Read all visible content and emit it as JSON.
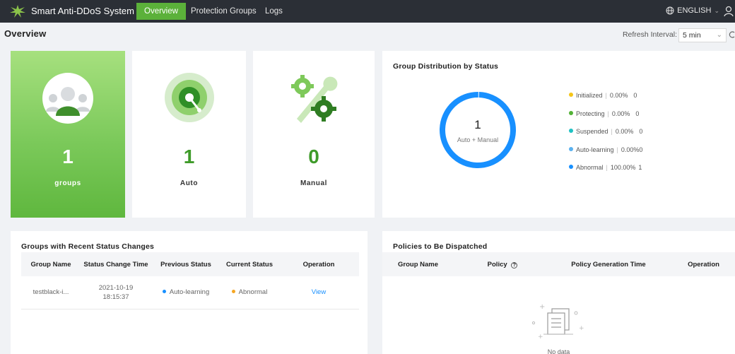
{
  "topbar": {
    "app_name": "Smart Anti-DDoS System",
    "tabs": [
      {
        "label": "Overview",
        "active": true
      },
      {
        "label": "Protection Groups",
        "active": false
      },
      {
        "label": "Logs",
        "active": false
      }
    ],
    "language": "ENGLISH"
  },
  "page": {
    "title": "Overview",
    "refresh_label": "Refresh Interval:",
    "refresh_value": "5 min"
  },
  "stats": {
    "groups": {
      "value": "1",
      "label": "groups"
    },
    "auto": {
      "value": "1",
      "label": "Auto"
    },
    "manual": {
      "value": "0",
      "label": "Manual"
    }
  },
  "distribution": {
    "title": "Group Distribution by Status",
    "total": "1",
    "subtitle": "Auto + Manual",
    "legend": [
      {
        "name": "Initialized",
        "percent": "0.00%",
        "count": "0",
        "color": "#f5c518"
      },
      {
        "name": "Protecting",
        "percent": "0.00%",
        "count": "0",
        "color": "#52b236"
      },
      {
        "name": "Suspended",
        "percent": "0.00%",
        "count": "0",
        "color": "#1fc1c3"
      },
      {
        "name": "Auto-learning",
        "percent": "0.00%",
        "count": "0",
        "color": "#5ab1ef"
      },
      {
        "name": "Abnormal",
        "percent": "100.00%",
        "count": "1",
        "color": "#1890ff"
      }
    ]
  },
  "chart_data": {
    "type": "pie",
    "title": "Group Distribution by Status",
    "categories": [
      "Initialized",
      "Protecting",
      "Suspended",
      "Auto-learning",
      "Abnormal"
    ],
    "values": [
      0,
      0,
      0,
      0,
      1
    ],
    "percentages": [
      0.0,
      0.0,
      0.0,
      0.0,
      100.0
    ],
    "legend_position": "right"
  },
  "recent_changes": {
    "title": "Groups with Recent Status Changes",
    "columns": [
      "Group Name",
      "Status Change Time",
      "Previous Status",
      "Current Status",
      "Operation"
    ],
    "rows": [
      {
        "group_name": "testblack-i...",
        "change_date": "2021-10-19",
        "change_time": "18:15:37",
        "previous_status": "Auto-learning",
        "previous_color": "#1890ff",
        "current_status": "Abnormal",
        "current_color": "#f5a623",
        "operation": "View"
      }
    ]
  },
  "policies": {
    "title": "Policies to Be Dispatched",
    "columns": [
      "Group Name",
      "Policy",
      "Policy Generation Time",
      "Operation"
    ],
    "empty_text": "No data"
  }
}
